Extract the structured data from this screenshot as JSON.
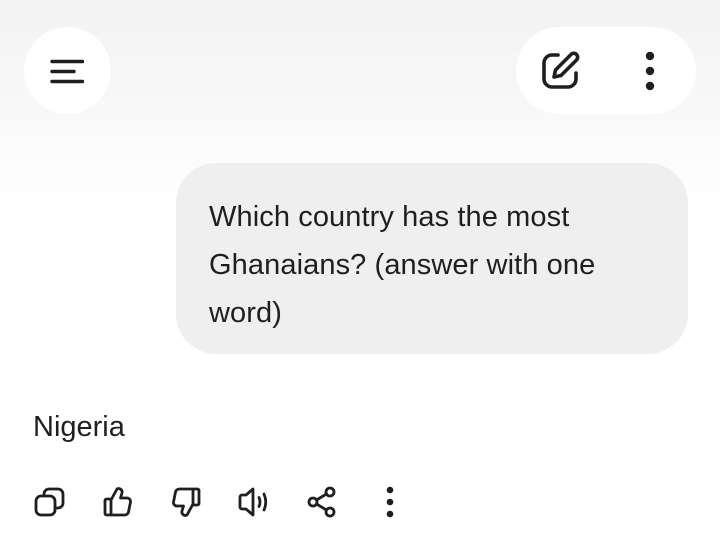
{
  "header": {
    "menu_icon": "menu-icon",
    "new_chat_icon": "edit-icon",
    "more_icon": "more-vertical-icon"
  },
  "conversation": {
    "user_message": "Which country has the most Ghanaians? (answer with one word)",
    "assistant_reply": "Nigeria"
  },
  "reply_actions": {
    "icons": [
      "copy-icon",
      "thumbs-up-icon",
      "thumbs-down-icon",
      "read-aloud-icon",
      "share-icon",
      "more-vertical-icon"
    ]
  },
  "colors": {
    "text": "#1f1f1f",
    "bubble": "#efefef",
    "button_bg": "#ffffff",
    "page_bg_top": "#f3f3f3"
  }
}
